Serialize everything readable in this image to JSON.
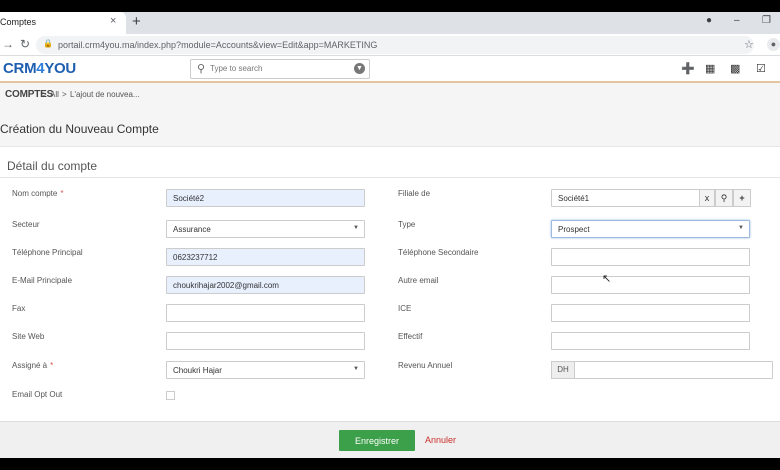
{
  "browser": {
    "tab_title": "Comptes",
    "tab_close": "×",
    "new_tab": "+",
    "url": "portail.crm4you.ma/index.php?module=Accounts&view=Edit&app=MARKETING"
  },
  "app": {
    "logo_main": "CRM",
    "logo_four": "4",
    "logo_end": "YOU",
    "search_placeholder": "Type to search"
  },
  "breadcrumb": {
    "module": "COMPTES",
    "sep1": ">",
    "all": "All",
    "sep2": ">",
    "current": "L'ajout de nouvea..."
  },
  "page": {
    "title": "Création du Nouveau Compte",
    "section": "Détail du compte"
  },
  "form": {
    "nom_compte": {
      "label": "Nom compte",
      "required": "*",
      "value": "Société2"
    },
    "filiale": {
      "label": "Filiale de",
      "value": "Société1",
      "clear": "x"
    },
    "secteur": {
      "label": "Secteur",
      "value": "Assurance"
    },
    "type": {
      "label": "Type",
      "value": "Prospect"
    },
    "tel_principal": {
      "label": "Téléphone Principal",
      "value": "0623237712"
    },
    "tel_secondaire": {
      "label": "Téléphone Secondaire",
      "value": ""
    },
    "email_principale": {
      "label": "E-Mail Principale",
      "value": "choukrihajar2002@gmail.com"
    },
    "autre_email": {
      "label": "Autre email",
      "value": ""
    },
    "fax": {
      "label": "Fax",
      "value": ""
    },
    "ice": {
      "label": "ICE",
      "value": ""
    },
    "site_web": {
      "label": "Site Web",
      "value": ""
    },
    "effectif": {
      "label": "Effectif",
      "value": ""
    },
    "assigne": {
      "label": "Assigné à",
      "required": "*",
      "value": "Choukri Hajar"
    },
    "revenu": {
      "label": "Revenu Annuel",
      "currency": "DH",
      "value": ""
    },
    "email_opt_out": {
      "label": "Email Opt Out",
      "checked": false
    }
  },
  "footer": {
    "save": "Enregistrer",
    "cancel": "Annuler"
  },
  "colors": {
    "primary": "#1f5fb0",
    "save": "#3c9f4a",
    "cancel": "#c9302c",
    "required": "#d9534f"
  }
}
